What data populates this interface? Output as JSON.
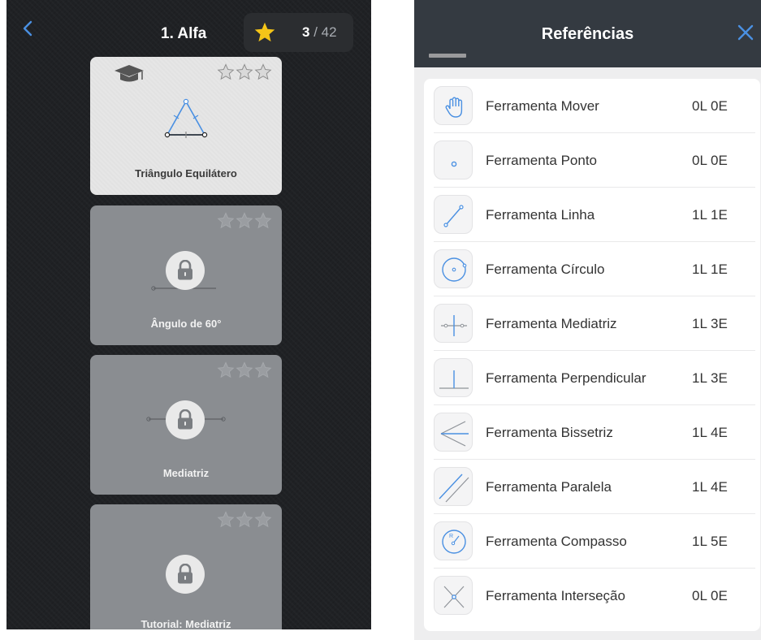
{
  "left": {
    "level_title": "1. Alfa",
    "stars_earned": "3",
    "stars_total": "/ 42",
    "cards": [
      {
        "title": "Triângulo Equilátero",
        "locked": false
      },
      {
        "title": "Ângulo de 60°",
        "locked": true
      },
      {
        "title": "Mediatriz",
        "locked": true
      },
      {
        "title": "Tutorial: Mediatriz",
        "locked": true
      }
    ]
  },
  "right": {
    "title": "Referências",
    "tools": [
      {
        "name": "Ferramenta Mover",
        "score": "0L  0E",
        "icon": "hand-icon"
      },
      {
        "name": "Ferramenta Ponto",
        "score": "0L  0E",
        "icon": "point-icon"
      },
      {
        "name": "Ferramenta Linha",
        "score": "1L  1E",
        "icon": "line-icon"
      },
      {
        "name": "Ferramenta Círculo",
        "score": "1L  1E",
        "icon": "circle-icon"
      },
      {
        "name": "Ferramenta Mediatriz",
        "score": "1L  3E",
        "icon": "bisector-icon"
      },
      {
        "name": "Ferramenta Perpendicular",
        "score": "1L  3E",
        "icon": "perpendicular-icon"
      },
      {
        "name": "Ferramenta Bissetriz",
        "score": "1L  4E",
        "icon": "angle-bisector-icon"
      },
      {
        "name": "Ferramenta Paralela",
        "score": "1L  4E",
        "icon": "parallel-icon"
      },
      {
        "name": "Ferramenta Compasso",
        "score": "1L  5E",
        "icon": "compass-icon"
      },
      {
        "name": "Ferramenta Interseção",
        "score": "0L  0E",
        "icon": "intersection-icon"
      }
    ]
  },
  "colors": {
    "accent": "#4a90e2",
    "star": "#f5c518",
    "dark_bg": "#1f2124",
    "header": "#343a41"
  }
}
